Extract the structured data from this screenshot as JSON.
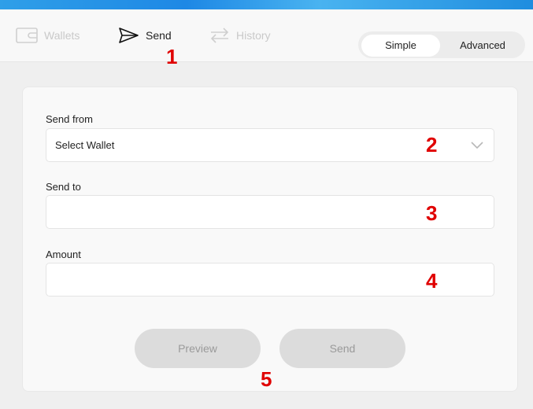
{
  "nav": {
    "wallets_label": "Wallets",
    "send_label": "Send",
    "history_label": "History"
  },
  "mode": {
    "simple_label": "Simple",
    "advanced_label": "Advanced",
    "selected": "Simple"
  },
  "form": {
    "send_from_label": "Send from",
    "send_from_value": "Select Wallet",
    "send_to_label": "Send to",
    "send_to_value": "",
    "amount_label": "Amount",
    "amount_value": ""
  },
  "buttons": {
    "preview_label": "Preview",
    "send_label": "Send"
  },
  "markers": [
    "1",
    "2",
    "3",
    "4",
    "5"
  ],
  "colors": {
    "banner": "#1e88e5",
    "marker": "#e00000",
    "button_disabled_bg": "#dcdcdc"
  },
  "icons": {
    "wallets": "wallet-icon",
    "send": "send-icon",
    "history": "history-arrows-icon",
    "dropdown": "chevron-down-icon"
  }
}
